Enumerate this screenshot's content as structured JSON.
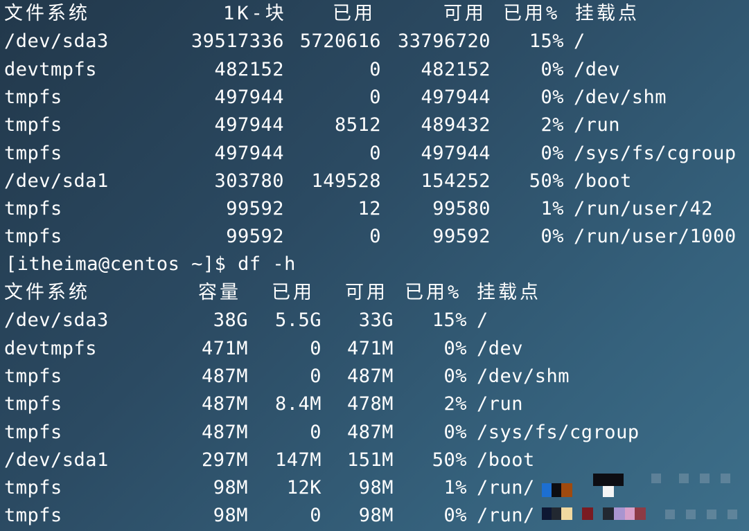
{
  "df_k": {
    "headers": [
      "文件系统",
      "1K-块",
      "已用",
      "可用",
      "已用%",
      "挂载点"
    ],
    "rows": [
      [
        "/dev/sda3",
        "39517336",
        "5720616",
        "33796720",
        "15%",
        "/"
      ],
      [
        "devtmpfs",
        "482152",
        "0",
        "482152",
        "0%",
        "/dev"
      ],
      [
        "tmpfs",
        "497944",
        "0",
        "497944",
        "0%",
        "/dev/shm"
      ],
      [
        "tmpfs",
        "497944",
        "8512",
        "489432",
        "2%",
        "/run"
      ],
      [
        "tmpfs",
        "497944",
        "0",
        "497944",
        "0%",
        "/sys/fs/cgroup"
      ],
      [
        "/dev/sda1",
        "303780",
        "149528",
        "154252",
        "50%",
        "/boot"
      ],
      [
        "tmpfs",
        "99592",
        "12",
        "99580",
        "1%",
        "/run/user/42"
      ],
      [
        "tmpfs",
        "99592",
        "0",
        "99592",
        "0%",
        "/run/user/1000"
      ]
    ]
  },
  "prompt": "[itheima@centos ~]$ df -h",
  "df_h": {
    "headers": [
      "文件系统",
      "容量",
      "已用",
      "可用",
      "已用%",
      "挂载点"
    ],
    "rows": [
      [
        "/dev/sda3",
        "38G",
        "5.5G",
        "33G",
        "15%",
        "/"
      ],
      [
        "devtmpfs",
        "471M",
        "0",
        "471M",
        "0%",
        "/dev"
      ],
      [
        "tmpfs",
        "487M",
        "0",
        "487M",
        "0%",
        "/dev/shm"
      ],
      [
        "tmpfs",
        "487M",
        "8.4M",
        "478M",
        "2%",
        "/run"
      ],
      [
        "tmpfs",
        "487M",
        "0",
        "487M",
        "0%",
        "/sys/fs/cgroup"
      ],
      [
        "/dev/sda1",
        "297M",
        "147M",
        "151M",
        "50%",
        "/boot"
      ],
      [
        "tmpfs",
        "98M",
        "12K",
        "98M",
        "1%",
        "/run/"
      ],
      [
        "tmpfs",
        "98M",
        "0",
        "98M",
        "0%",
        "/run/"
      ]
    ]
  },
  "colors": {
    "background": "#2b4a62",
    "text": "#ffffff",
    "mosaic": [
      "#1d6fd1",
      "#0d0d12",
      "#a04a0e",
      "#222831",
      "#0e1733",
      "#f1d9a0",
      "#7a1b22",
      "#a995d0",
      "#d8a0c9",
      "#8d3b45",
      "#f4f4f4"
    ]
  }
}
